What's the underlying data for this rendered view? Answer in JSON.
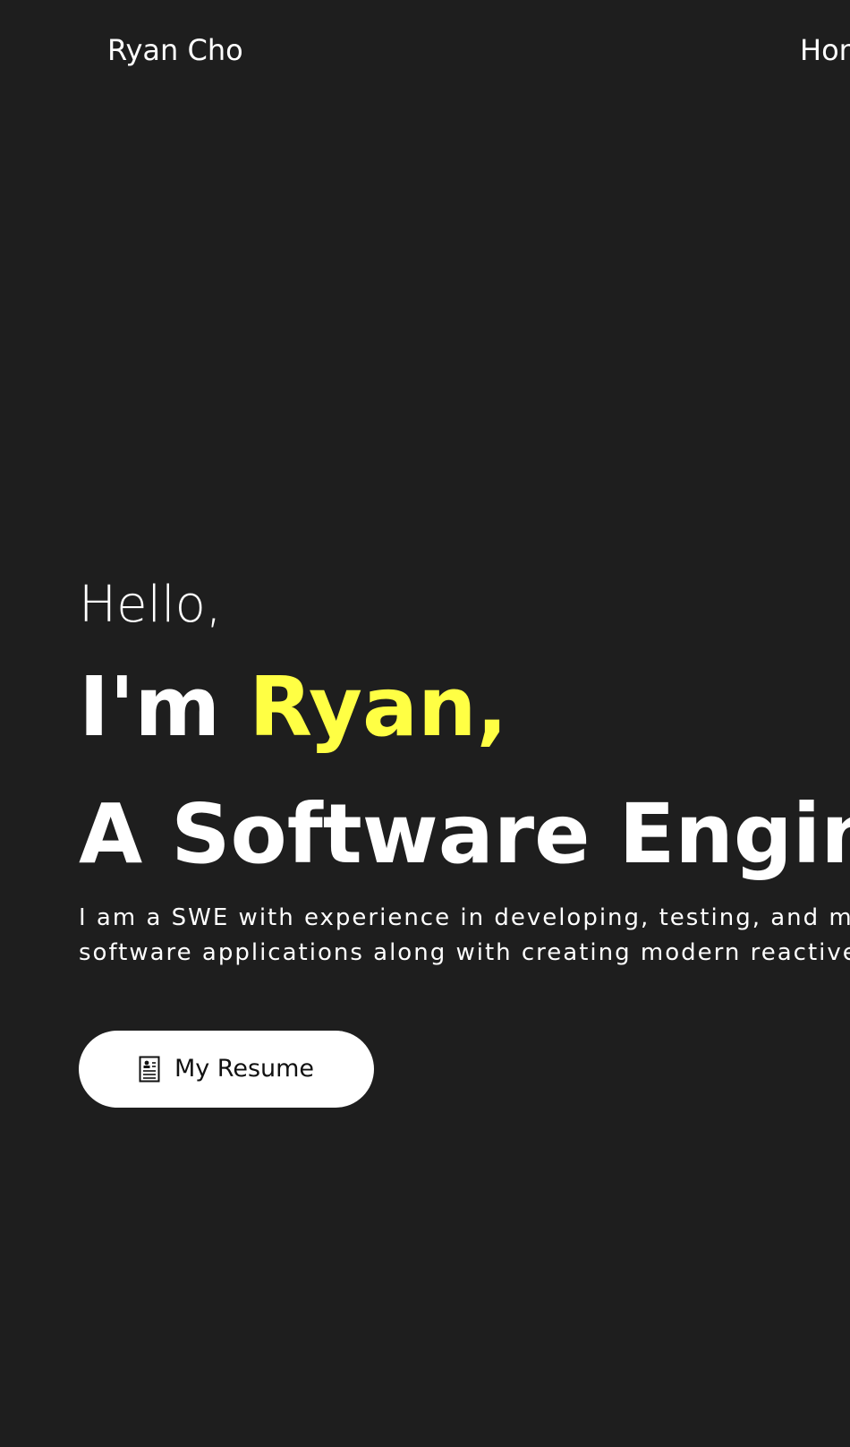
{
  "header": {
    "brand": "Ryan Cho",
    "nav_items": [
      "Home"
    ]
  },
  "hero": {
    "greeting": "Hello,",
    "intro_prefix": "I'm ",
    "name": "Ryan,",
    "role": "A Software Engineer",
    "bio_lines": [
      "I am a SWE with experience in developing, testing, and maintaining",
      "software applications along with creating modern reactive web apps."
    ],
    "resume_button": {
      "label": "My Resume",
      "icon": "resume-icon"
    }
  },
  "colors": {
    "background": "#1e1e1e",
    "text": "#ffffff",
    "accent": "#ffff44",
    "button_bg": "#ffffff",
    "button_text": "#111111"
  }
}
